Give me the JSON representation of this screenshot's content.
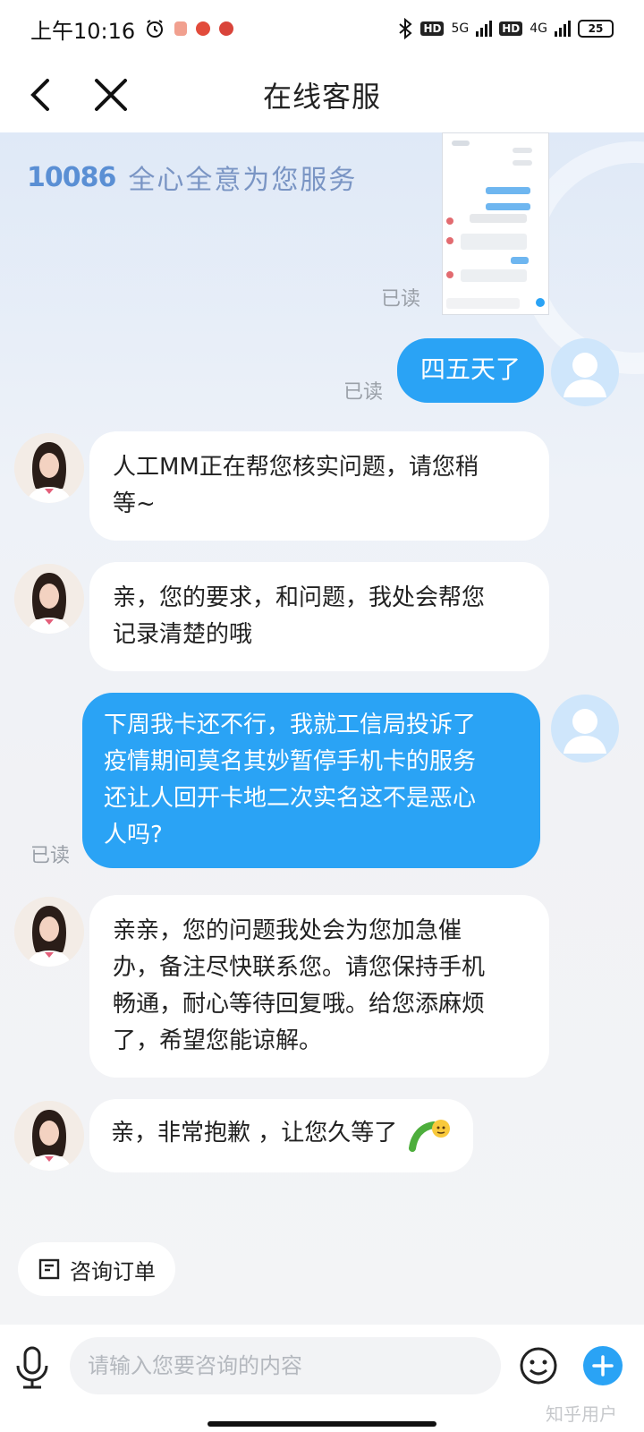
{
  "status_bar": {
    "time": "上午10:16",
    "network_1": "5G",
    "network_2": "4G",
    "hd_1": "HD",
    "hd_2": "HD",
    "battery": "25"
  },
  "nav": {
    "title": "在线客服"
  },
  "banner": {
    "logo": "10086",
    "slogan": "全心全意为您服务"
  },
  "messages": [
    {
      "id": "m1",
      "from": "user",
      "type": "image",
      "read": "已读"
    },
    {
      "id": "m2",
      "from": "user",
      "text": "四五天了",
      "read": "已读"
    },
    {
      "id": "m3",
      "from": "agent",
      "lines": [
        "人工MM正在帮您核实问题，请您稍",
        "等~"
      ]
    },
    {
      "id": "m4",
      "from": "agent",
      "lines": [
        "亲，您的要求，和问题，我处会帮您",
        "记录清楚的哦"
      ]
    },
    {
      "id": "m5",
      "from": "user",
      "lines": [
        "下周我卡还不行，我就工信局投诉了",
        "疫情期间莫名其妙暂停手机卡的服务",
        "还让人回开卡地二次实名这不是恶心",
        "人吗?"
      ],
      "read": "已读"
    },
    {
      "id": "m6",
      "from": "agent",
      "lines": [
        "亲亲，您的问题我处会为您加急催",
        "办，备注尽快联系您。请您保持手机",
        "畅通，耐心等待回复哦。给您添麻烦",
        "了，希望您能谅解。"
      ]
    },
    {
      "id": "m7",
      "from": "agent",
      "text": "亲，非常抱歉 ，让您久等了",
      "emoji": "embarrassed-sweat-emoji"
    }
  ],
  "quick_actions": {
    "order_label": "咨询订单"
  },
  "input": {
    "placeholder": "请输入您要咨询的内容"
  },
  "watermark": "知乎用户",
  "colors": {
    "user_bubble": "#2aa3f5",
    "agent_bubble": "#ffffff",
    "read_label": "#9aa0a8",
    "accent": "#2aa3f5"
  }
}
